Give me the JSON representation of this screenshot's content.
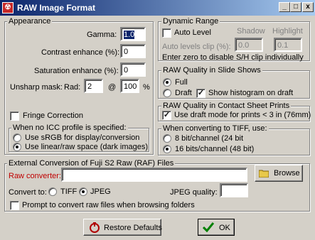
{
  "window": {
    "title": "RAW Image Format",
    "minimize": "_",
    "maximize": "□",
    "close": "x"
  },
  "appearance": {
    "legend": "Appearance",
    "gamma_label": "Gamma:",
    "gamma_value": "1.0",
    "contrast_label": "Contrast enhance (%):",
    "contrast_value": "0",
    "saturation_label": "Saturation enhance (%):",
    "saturation_value": "0",
    "unsharp_label": "Unsharp mask:",
    "rad_label": "Rad:",
    "rad_value": "2",
    "at_label": "@",
    "pct_value": "100",
    "pct_label": "%",
    "fringe_label": "Fringe Correction"
  },
  "icc": {
    "legend": "When no ICC profile is specified:",
    "option_srgb": "Use sRGB for display/conversion",
    "option_linear": "Use linear/raw space (dark images)",
    "selected": "linear"
  },
  "dynamic_range": {
    "legend": "Dynamic Range",
    "shadow_label": "Shadow",
    "highlight_label": "Highlight",
    "auto_level_label": "Auto Level",
    "clip_label": "Auto levels clip (%):",
    "shadow_value": "0.0",
    "highlight_value": "0.1",
    "note": "Enter zero to disable S/H clip individually"
  },
  "slideshow": {
    "legend": "RAW Quality in Slide Shows",
    "option_full": "Full",
    "option_draft": "Draft",
    "histogram_label": "Show histogram on draft",
    "selected": "full"
  },
  "contact_sheet": {
    "legend": "RAW Quality in Contact Sheet Prints",
    "draft_label": "Use draft mode for prints < 3 in (76mm)"
  },
  "tiff": {
    "legend": "When converting to TIFF, use:",
    "option_8": "8 bit/channel (24 bit",
    "option_16": "16 bits/channel (48 bit)",
    "selected": "16"
  },
  "external": {
    "legend": "External Conversion of Fuji S2 Raw (RAF) Files",
    "converter_label": "Raw converter:",
    "converter_value": "",
    "browse_label": "Browse",
    "convert_to_label": "Convert to:",
    "option_tiff": "TIFF",
    "option_jpeg": "JPEG",
    "jpeg_quality_label": "JPEG quality:",
    "jpeg_quality_value": "",
    "prompt_label": "Prompt to convert raw files when browsing folders"
  },
  "buttons": {
    "restore": "Restore Defaults",
    "ok": "OK"
  },
  "colors": {
    "accent": "#0a246a",
    "converter_label": "#c00000",
    "ok_check": "#008000"
  }
}
